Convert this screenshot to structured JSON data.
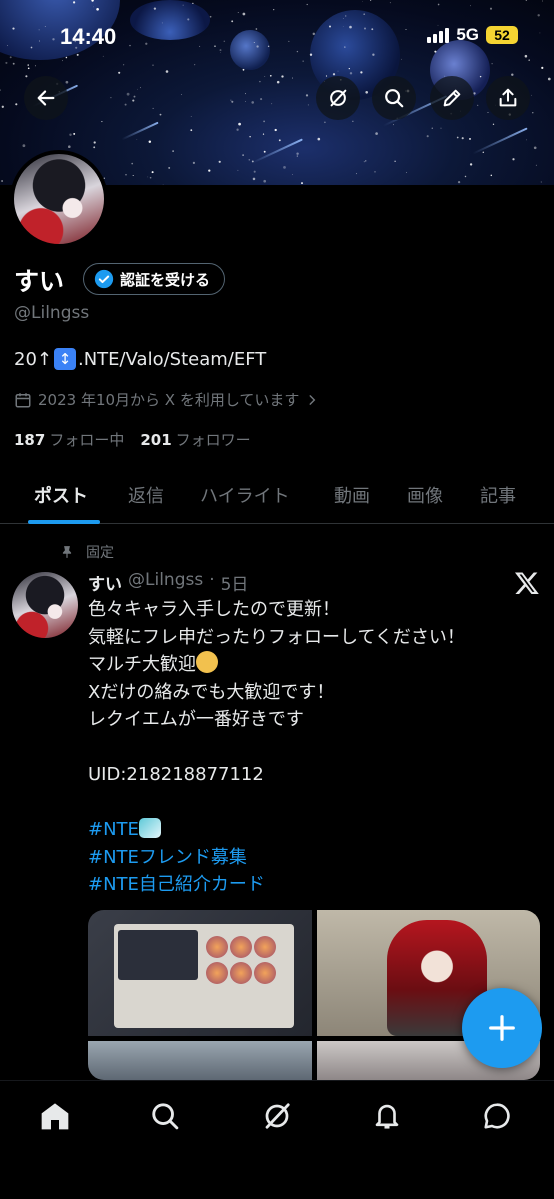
{
  "status_bar": {
    "time": "14:40",
    "network": "5G",
    "battery": "52"
  },
  "profile": {
    "name": "すい",
    "verify_button": "認証を受ける",
    "handle": "@Lilngss",
    "bio_prefix": "20↑",
    "bio_emoji": "↕",
    "bio_suffix": ".NTE/Valo/Steam/EFT",
    "joined": "2023 年10月から X を利用しています",
    "following_count": "187",
    "following_label": "フォロー中",
    "followers_count": "201",
    "followers_label": "フォロワー"
  },
  "tabs": [
    "ポスト",
    "返信",
    "ハイライト",
    "動画",
    "画像",
    "記事"
  ],
  "post": {
    "pinned_label": "固定",
    "author": "すい",
    "handle": "@Lilngss",
    "time": "5日",
    "lines": [
      "色々キャラ入手したので更新！",
      "気軽にフレ申だったりフォローしてください！",
      "マルチ大歓迎",
      "Xだけの絡みでも大歓迎です！",
      "レクイエムが一番好きです",
      "",
      "UID:218218877112",
      ""
    ],
    "hashtags": [
      "#NTE",
      "#NTEフレンド募集",
      "#NTE自己紹介カード"
    ]
  },
  "icons": {
    "back": "back-arrow-icon",
    "grok": "grok-icon",
    "search": "search-icon",
    "edit": "pencil-icon",
    "share": "share-icon",
    "compose": "plus-icon",
    "nav": [
      "home-icon",
      "search-icon",
      "grok-icon",
      "bell-icon",
      "message-icon"
    ]
  },
  "colors": {
    "accent": "#1d9bf0",
    "muted": "#71767b",
    "text": "#e7e9ea",
    "background": "#000000"
  }
}
